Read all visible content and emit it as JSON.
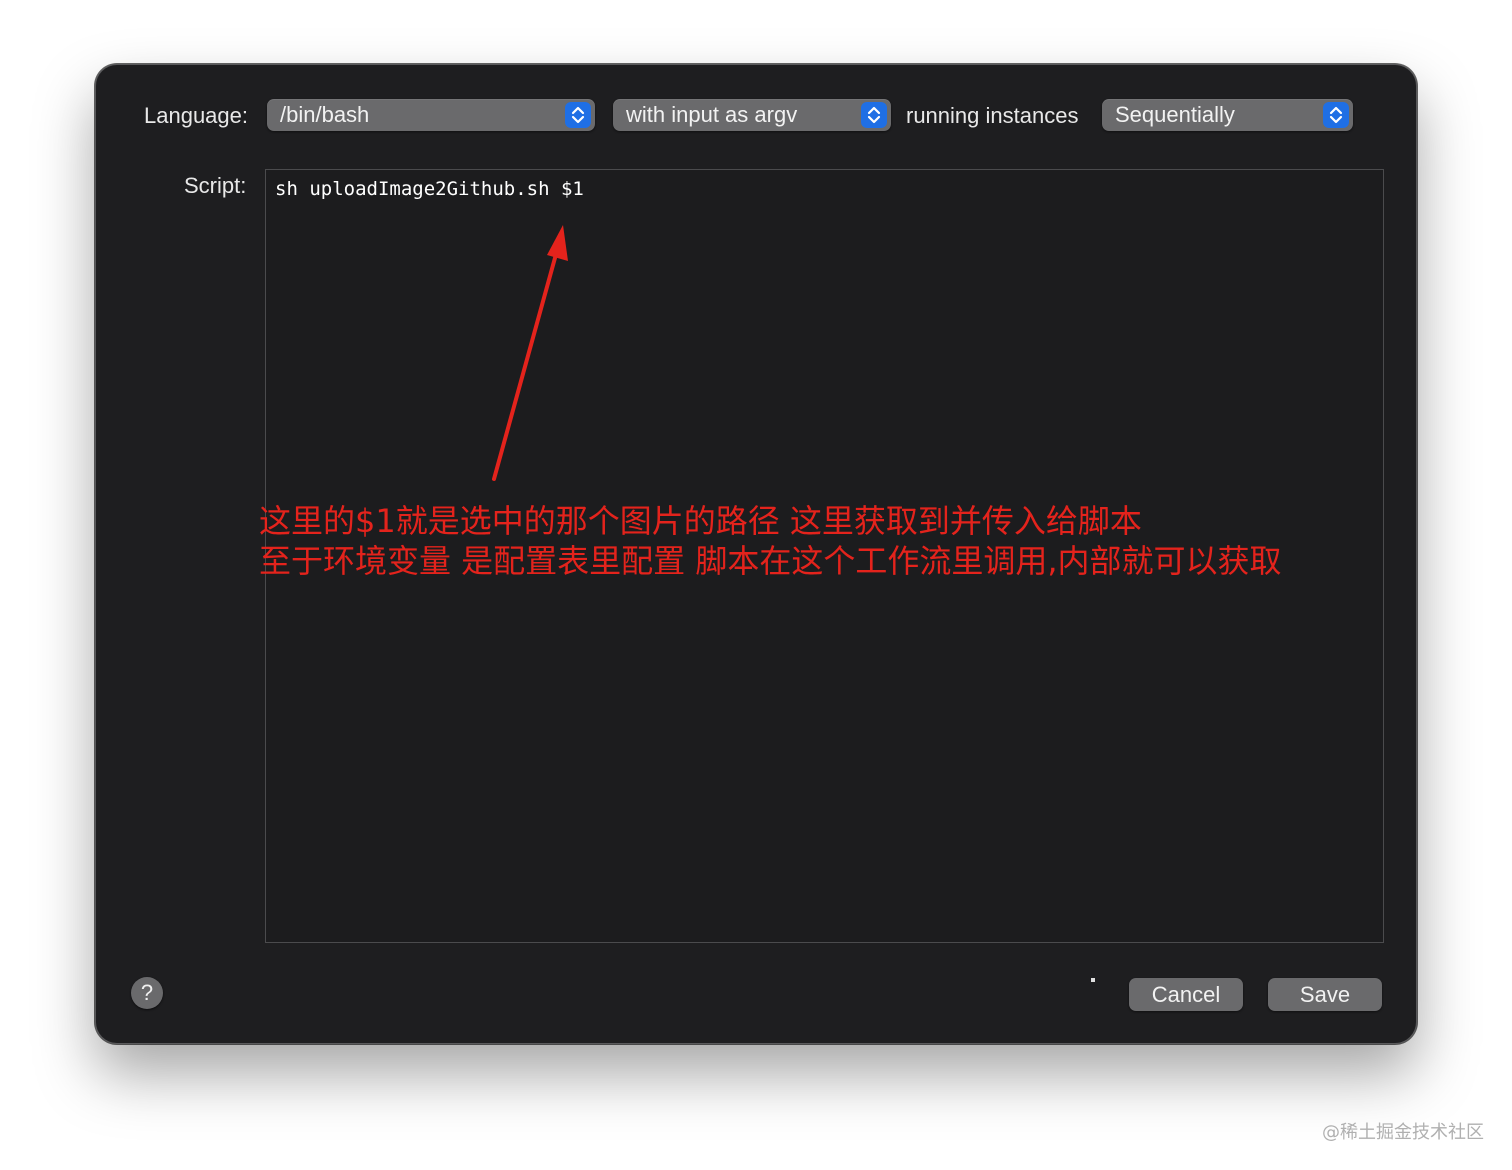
{
  "dialog": {
    "language_label": "Language:",
    "language_value": "/bin/bash",
    "input_mode_value": "with input as argv",
    "instances_label": "running instances",
    "instances_value": "Sequentially",
    "script_label": "Script:",
    "script_code": "sh uploadImage2Github.sh $1",
    "help_label": "?",
    "cancel_label": "Cancel",
    "save_label": "Save"
  },
  "annotation": {
    "line1": "这里的$1就是选中的那个图片的路径  这里获取到并传入给脚本",
    "line2": "至于环境变量 是配置表里配置 脚本在这个工作流里调用,内部就可以获取",
    "color": "#e4231c"
  },
  "watermark": "@稀土掘金技术社区",
  "icons": {
    "popup_chevron": "chevron-up-down-icon",
    "arrow": "red-arrow-icon"
  },
  "colors": {
    "accent": "#1f6fe5",
    "dialog_bg": "#1e1e20"
  }
}
